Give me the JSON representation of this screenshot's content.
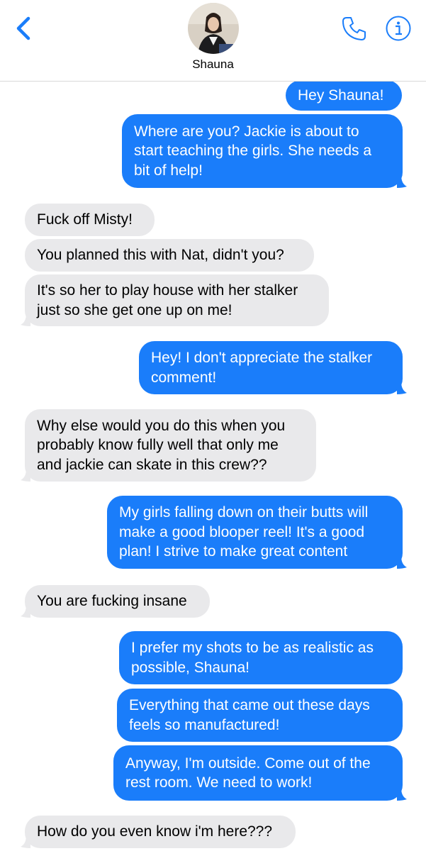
{
  "header": {
    "contact_name": "Shauna",
    "back_icon": "chevron-left-icon",
    "call_icon": "phone-icon",
    "info_icon": "info-icon",
    "accent_color": "#1a7dfa"
  },
  "colors": {
    "sent_bubble": "#1a7dfa",
    "received_bubble": "#e9e9eb"
  },
  "messages": [
    {
      "sender": "me",
      "lines": [
        "Hey Shauna!"
      ]
    },
    {
      "sender": "me",
      "lines": [
        "Where are you? Jackie is about to",
        "start teaching the girls. She needs a",
        "bit of help!"
      ]
    },
    {
      "sender": "them",
      "lines": [
        "Fuck off Misty!"
      ]
    },
    {
      "sender": "them",
      "lines": [
        "You planned this with Nat, didn't you?"
      ]
    },
    {
      "sender": "them",
      "lines": [
        "It's so her to play house with her stalker",
        "just so she get one up on me!"
      ]
    },
    {
      "sender": "me",
      "lines": [
        "Hey! I don't appreciate the stalker",
        "comment!"
      ]
    },
    {
      "sender": "them",
      "lines": [
        "Why else would you do this when you",
        "probably know fully well that only me",
        "and jackie can skate in this crew??"
      ]
    },
    {
      "sender": "me",
      "lines": [
        "My girls falling down on their butts will",
        "make a good blooper reel! It's a good",
        "plan! I strive to make great content"
      ]
    },
    {
      "sender": "them",
      "lines": [
        "You are fucking insane"
      ]
    },
    {
      "sender": "me",
      "lines": [
        "I prefer my shots to be as realistic as",
        "possible, Shauna!"
      ]
    },
    {
      "sender": "me",
      "lines": [
        "Everything that came out these days",
        "feels so manufactured!"
      ]
    },
    {
      "sender": "me",
      "lines": [
        "Anyway, I'm outside. Come out of the",
        "rest room. We need to work!"
      ]
    },
    {
      "sender": "them",
      "lines": [
        "How do you even know i'm here???"
      ]
    }
  ]
}
